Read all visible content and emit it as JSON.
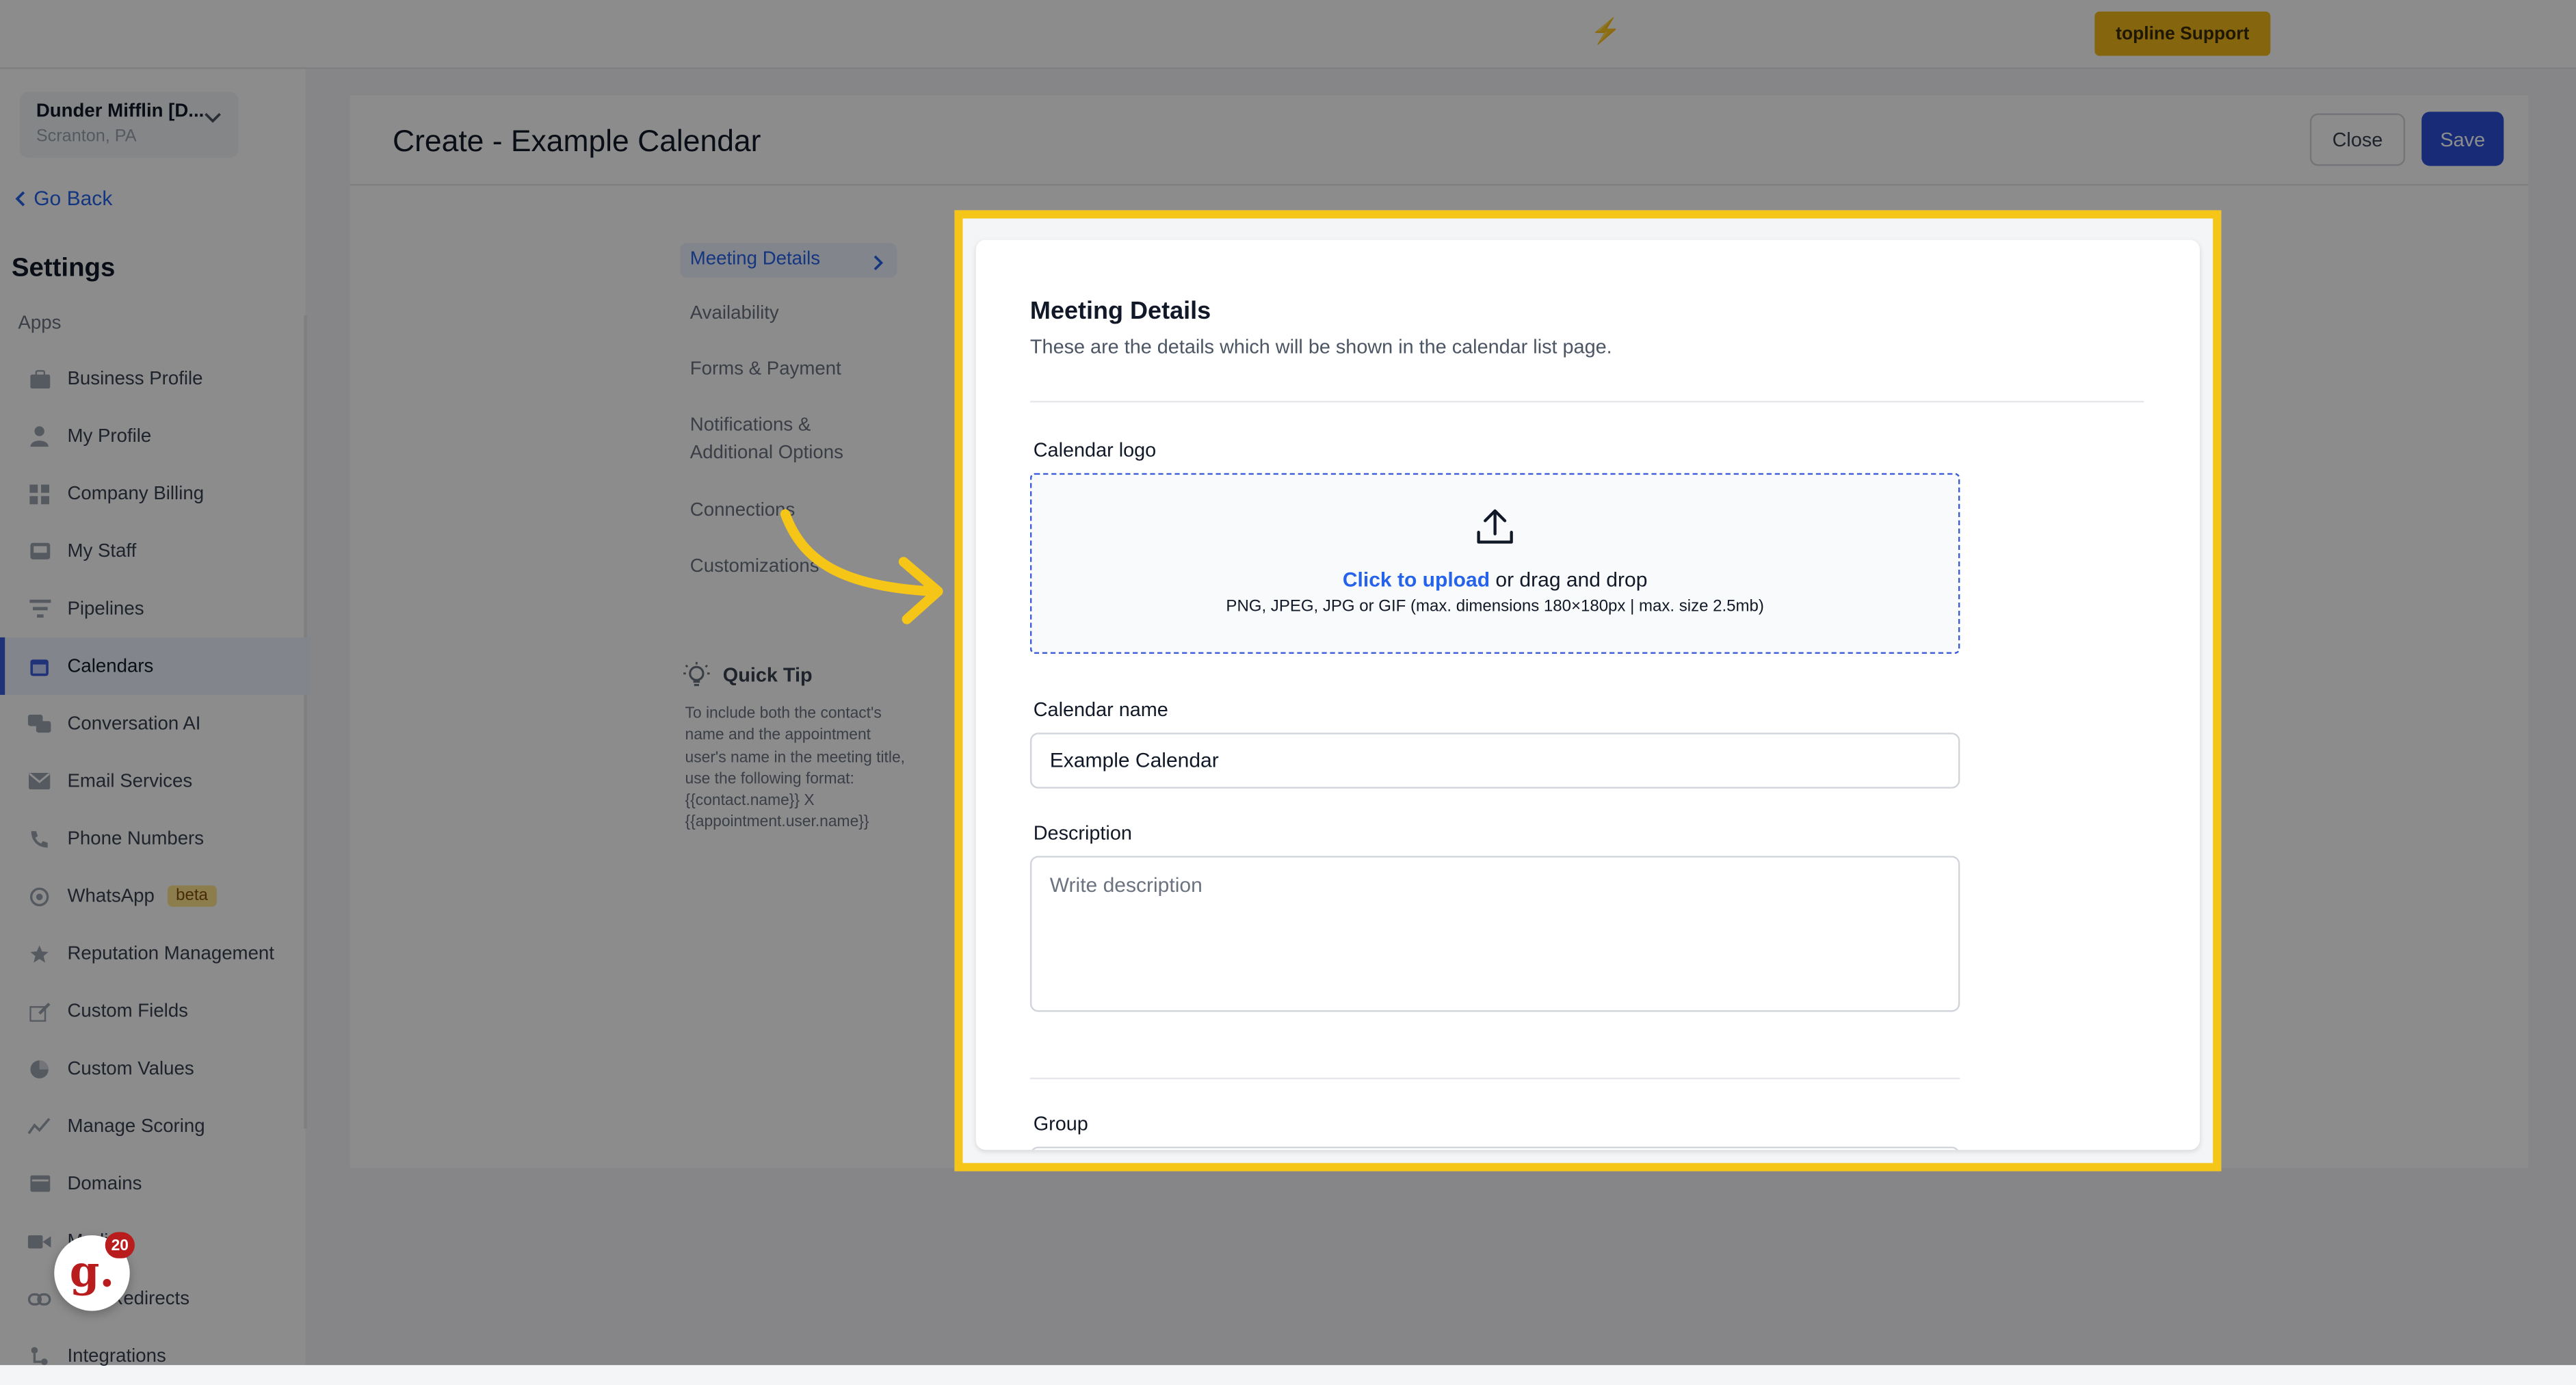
{
  "topbar": {
    "support_label": "topline Support"
  },
  "account": {
    "name": "Dunder Mifflin [D...",
    "location": "Scranton, PA"
  },
  "sidebar": {
    "go_back": "Go Back",
    "title": "Settings",
    "section_label": "Apps",
    "items": [
      {
        "label": "Business Profile",
        "icon": "briefcase-icon"
      },
      {
        "label": "My Profile",
        "icon": "person-icon"
      },
      {
        "label": "Company Billing",
        "icon": "grid-icon"
      },
      {
        "label": "My Staff",
        "icon": "inbox-icon"
      },
      {
        "label": "Pipelines",
        "icon": "filter-icon"
      },
      {
        "label": "Calendars",
        "icon": "calendar-icon",
        "active": true
      },
      {
        "label": "Conversation AI",
        "icon": "chat-icon"
      },
      {
        "label": "Email Services",
        "icon": "mail-icon"
      },
      {
        "label": "Phone Numbers",
        "icon": "phone-icon"
      },
      {
        "label": "WhatsApp",
        "icon": "whatsapp-icon",
        "badge": "beta"
      },
      {
        "label": "Reputation Management",
        "icon": "star-icon"
      },
      {
        "label": "Custom Fields",
        "icon": "edit-icon"
      },
      {
        "label": "Custom Values",
        "icon": "pie-icon"
      },
      {
        "label": "Manage Scoring",
        "icon": "chart-icon"
      },
      {
        "label": "Domains",
        "icon": "window-icon"
      },
      {
        "label": "Media",
        "icon": "video-icon"
      },
      {
        "label": "URL Redirects",
        "icon": "link-icon"
      },
      {
        "label": "Integrations",
        "icon": "plug-icon"
      }
    ],
    "notification_count": "20"
  },
  "header": {
    "title": "Create - Example Calendar",
    "close_label": "Close",
    "save_label": "Save"
  },
  "steps": [
    {
      "label": "Meeting Details",
      "active": true
    },
    {
      "label": "Availability"
    },
    {
      "label": "Forms & Payment"
    },
    {
      "label": "Notifications & Additional Options"
    },
    {
      "label": "Connections"
    },
    {
      "label": "Customizations"
    }
  ],
  "quick_tip": {
    "title": "Quick Tip",
    "text": "To include both the contact's name and the appointment user's name in the meeting title, use the following format: {{contact.name}} X {{appointment.user.name}}"
  },
  "form": {
    "section_title": "Meeting Details",
    "section_subtitle": "These are the details which will be shown in the calendar list page.",
    "logo_label": "Calendar logo",
    "upload_link": "Click to upload",
    "upload_rest": " or drag and drop",
    "upload_hint": "PNG, JPEG, JPG or GIF (max. dimensions 180×180px | max. size 2.5mb)",
    "name_label": "Calendar name",
    "name_value": "Example Calendar",
    "description_label": "Description",
    "description_placeholder": "Write description",
    "group_label": "Group"
  },
  "colors": {
    "highlight": "#f5c518",
    "accent": "#2b4fd8",
    "link": "#2563eb"
  }
}
